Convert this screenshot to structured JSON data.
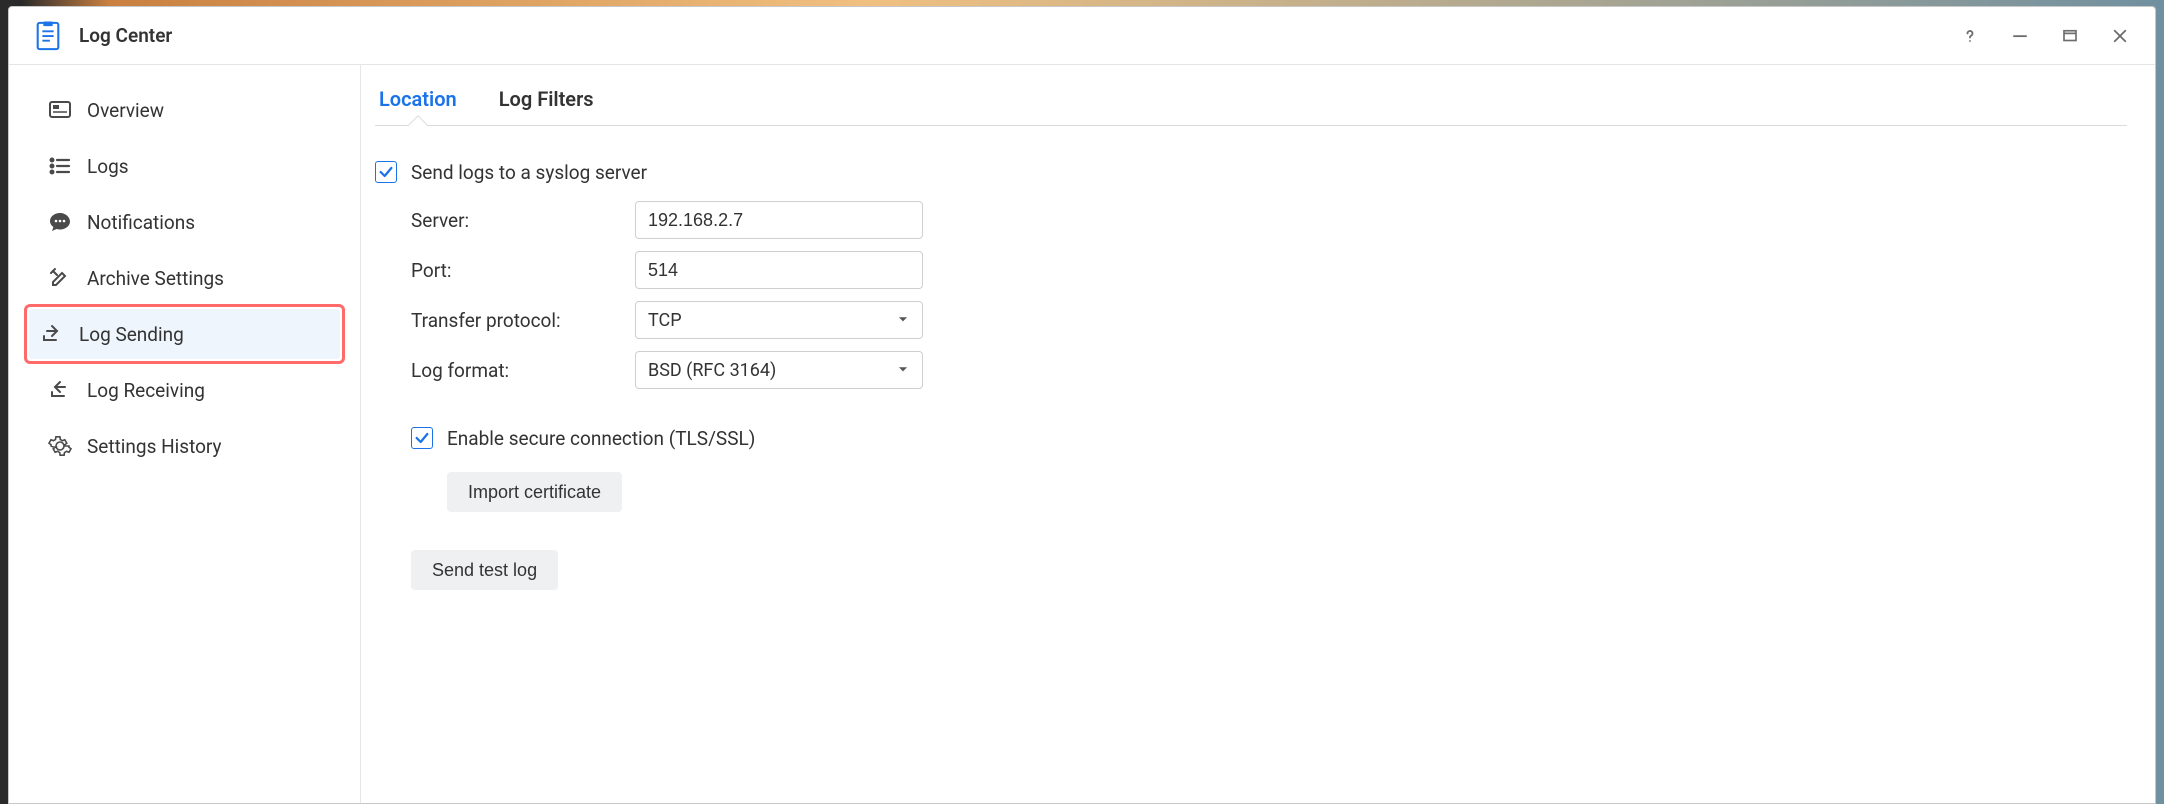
{
  "app": {
    "title": "Log Center"
  },
  "sidebar": {
    "items": [
      {
        "label": "Overview",
        "icon": "dashboard-icon"
      },
      {
        "label": "Logs",
        "icon": "list-icon"
      },
      {
        "label": "Notifications",
        "icon": "chat-icon"
      },
      {
        "label": "Archive Settings",
        "icon": "tools-icon"
      },
      {
        "label": "Log Sending",
        "icon": "send-icon",
        "active": true,
        "highlighted": true
      },
      {
        "label": "Log Receiving",
        "icon": "receive-icon"
      },
      {
        "label": "Settings History",
        "icon": "gear-icon"
      }
    ]
  },
  "tabs": [
    {
      "label": "Location",
      "active": true
    },
    {
      "label": "Log Filters",
      "active": false
    }
  ],
  "form": {
    "send_enabled": true,
    "send_label": "Send logs to a syslog server",
    "server_label": "Server:",
    "server_value": "192.168.2.7",
    "port_label": "Port:",
    "port_value": "514",
    "protocol_label": "Transfer protocol:",
    "protocol_value": "TCP",
    "format_label": "Log format:",
    "format_value": "BSD (RFC 3164)",
    "tls_enabled": true,
    "tls_label": "Enable secure connection (TLS/SSL)",
    "import_cert_label": "Import certificate",
    "send_test_label": "Send test log"
  }
}
